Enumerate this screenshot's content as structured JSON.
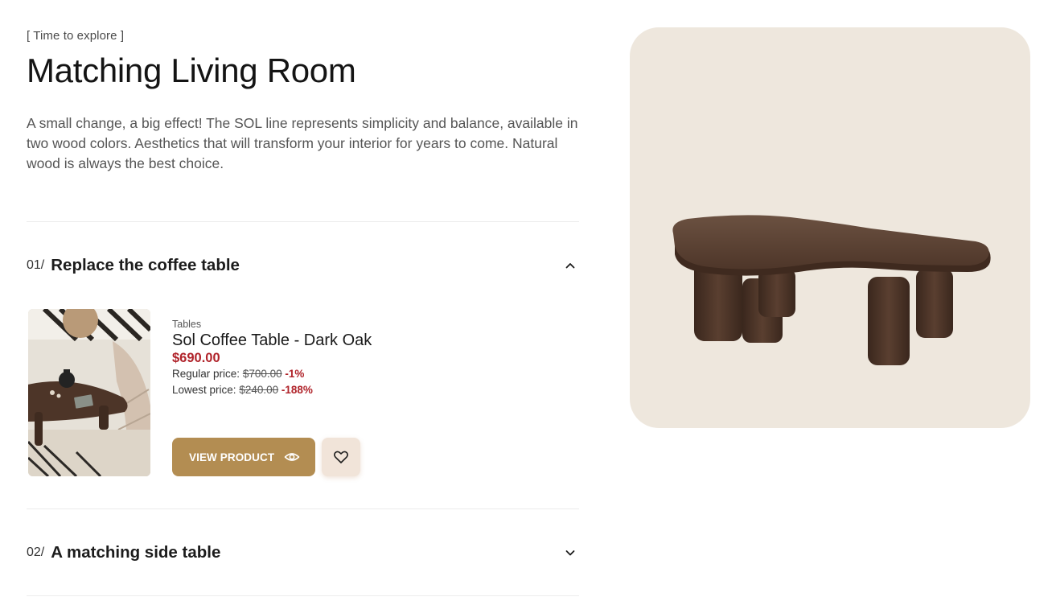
{
  "section": {
    "eyebrow": "[ Time to explore ]",
    "title": "Matching Living Room",
    "description": "A small change, a big effect! The SOL line represents simplicity and balance, available in two wood colors. Aesthetics that will transform your interior for years to come. Natural wood is always the best choice."
  },
  "accordion": [
    {
      "number": "01/",
      "title": "Replace the coffee table",
      "expanded": true,
      "icon": "chevron-up-icon"
    },
    {
      "number": "02/",
      "title": "A matching side table",
      "expanded": false,
      "icon": "chevron-down-icon"
    }
  ],
  "product": {
    "category": "Tables",
    "name": "Sol Coffee Table - Dark Oak",
    "price": "$690.00",
    "regular_label": "Regular price:",
    "regular_price": "$700.00",
    "regular_discount": "-1%",
    "lowest_label": "Lowest price:",
    "lowest_price": "$240.00",
    "lowest_discount": "-188%",
    "view_label": "VIEW PRODUCT",
    "view_icon": "eye-icon",
    "wishlist_icon": "heart-icon"
  },
  "colors": {
    "accent_button": "#b38d52",
    "sale_red": "#b0232a",
    "hero_background": "#eee7dd",
    "wishlist_background": "#f1e4d9"
  }
}
